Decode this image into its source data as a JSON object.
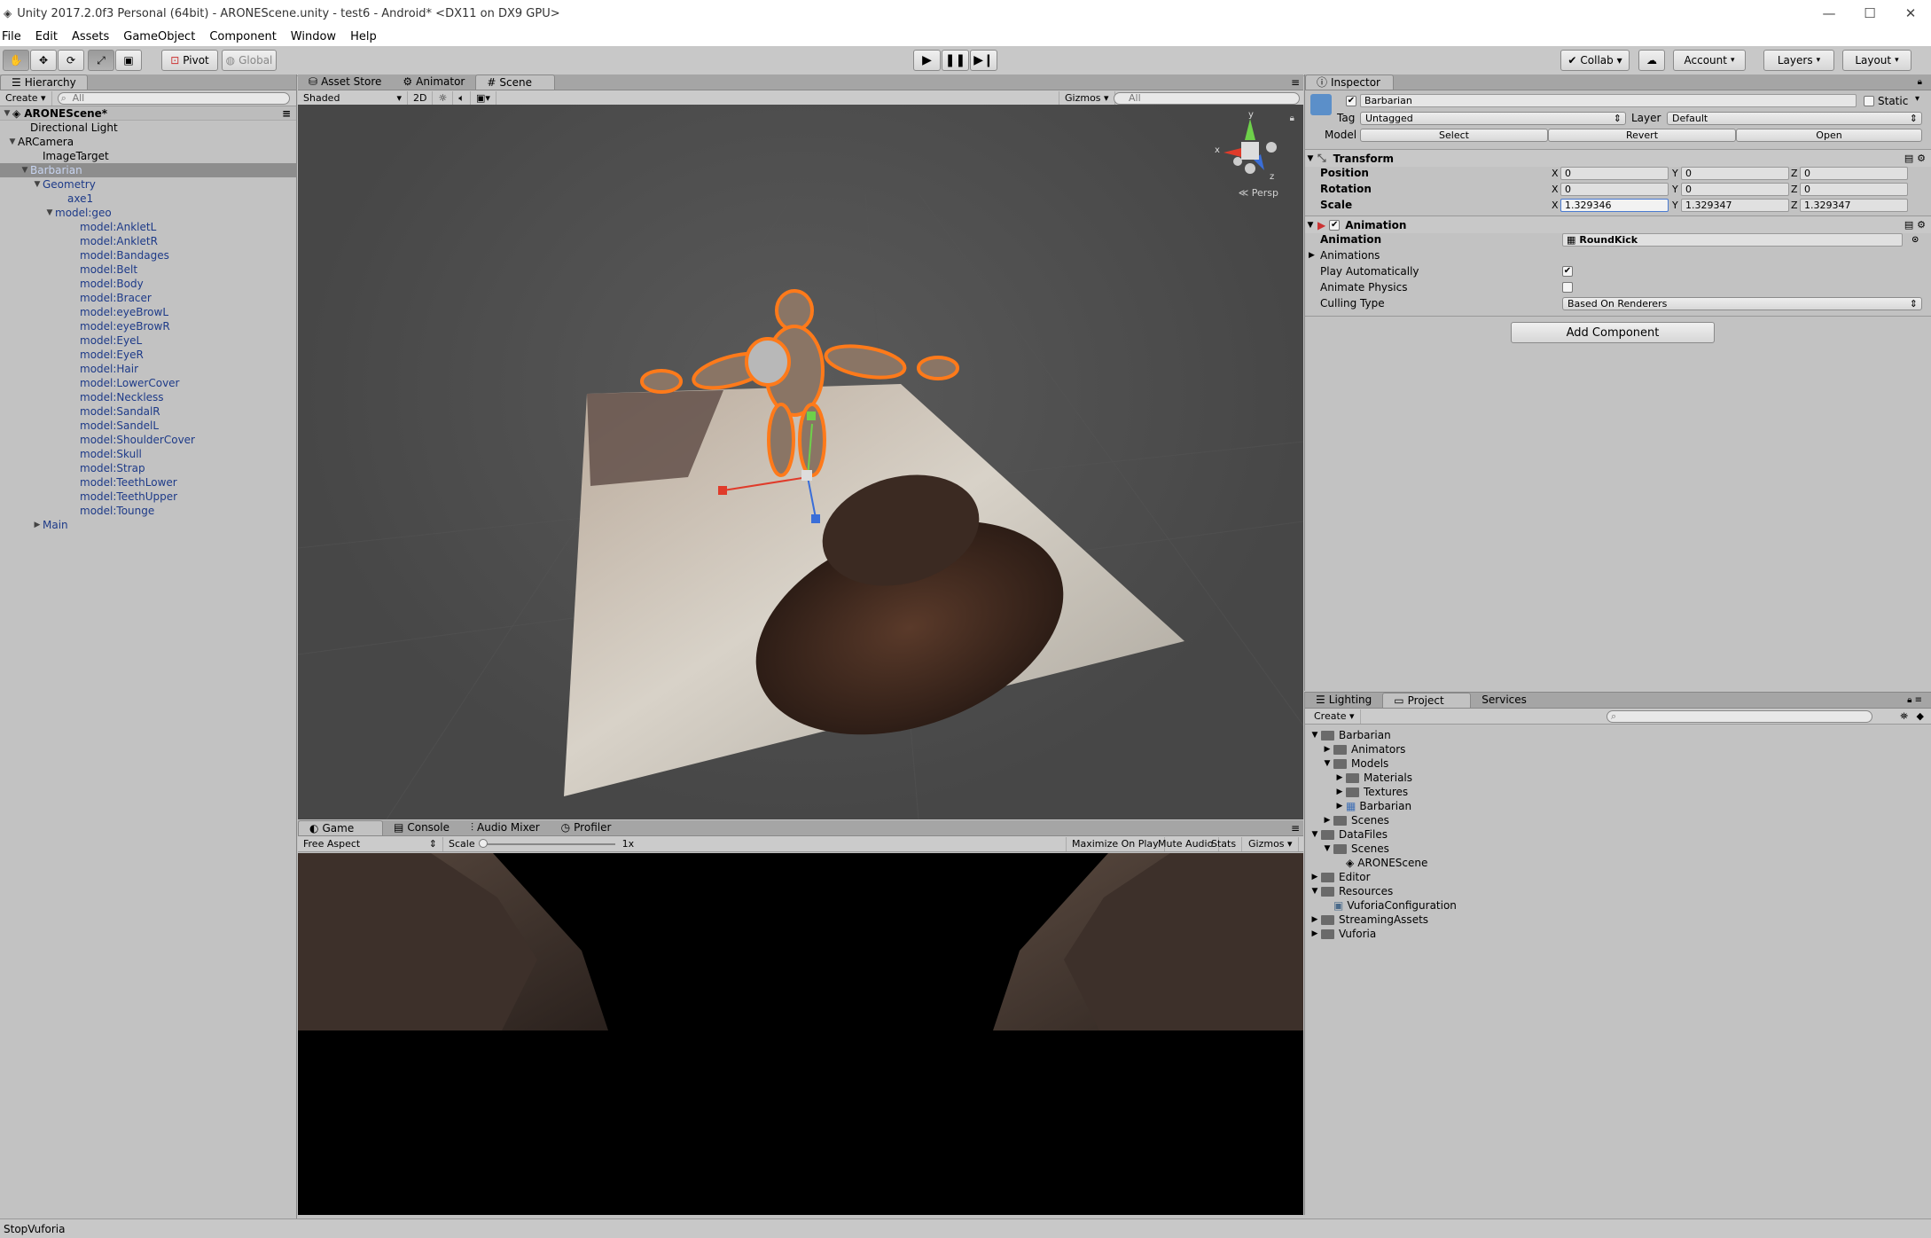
{
  "window": {
    "title": "Unity 2017.2.0f3 Personal (64bit) - ARONEScene.unity - test6 - Android* <DX11 on DX9 GPU>"
  },
  "menu": [
    "File",
    "Edit",
    "Assets",
    "GameObject",
    "Component",
    "Window",
    "Help"
  ],
  "toolbar": {
    "pivot": "Pivot",
    "global": "Global",
    "collab": "Collab ▾",
    "account": "Account",
    "layers": "Layers",
    "layout": "Layout"
  },
  "hierarchy": {
    "tab": "Hierarchy",
    "create": "Create ▾",
    "search": "All",
    "scene": "ARONEScene*",
    "items": [
      {
        "label": "Directional Light",
        "indent": 1,
        "arrow": "",
        "style": ""
      },
      {
        "label": "ARCamera",
        "indent": 0,
        "arrow": "▼",
        "style": ""
      },
      {
        "label": "ImageTarget",
        "indent": 2,
        "arrow": "",
        "style": ""
      },
      {
        "label": "Barbarian",
        "indent": 1,
        "arrow": "▼",
        "style": "sel"
      },
      {
        "label": "Geometry",
        "indent": 2,
        "arrow": "▼",
        "style": "blue"
      },
      {
        "label": "axe1",
        "indent": 4,
        "arrow": "",
        "style": "blue"
      },
      {
        "label": "model:geo",
        "indent": 3,
        "arrow": "▼",
        "style": "blue"
      },
      {
        "label": "model:AnkletL",
        "indent": 5,
        "arrow": "",
        "style": "blue"
      },
      {
        "label": "model:AnkletR",
        "indent": 5,
        "arrow": "",
        "style": "blue"
      },
      {
        "label": "model:Bandages",
        "indent": 5,
        "arrow": "",
        "style": "blue"
      },
      {
        "label": "model:Belt",
        "indent": 5,
        "arrow": "",
        "style": "blue"
      },
      {
        "label": "model:Body",
        "indent": 5,
        "arrow": "",
        "style": "blue"
      },
      {
        "label": "model:Bracer",
        "indent": 5,
        "arrow": "",
        "style": "blue"
      },
      {
        "label": "model:eyeBrowL",
        "indent": 5,
        "arrow": "",
        "style": "blue"
      },
      {
        "label": "model:eyeBrowR",
        "indent": 5,
        "arrow": "",
        "style": "blue"
      },
      {
        "label": "model:EyeL",
        "indent": 5,
        "arrow": "",
        "style": "blue"
      },
      {
        "label": "model:EyeR",
        "indent": 5,
        "arrow": "",
        "style": "blue"
      },
      {
        "label": "model:Hair",
        "indent": 5,
        "arrow": "",
        "style": "blue"
      },
      {
        "label": "model:LowerCover",
        "indent": 5,
        "arrow": "",
        "style": "blue"
      },
      {
        "label": "model:Neckless",
        "indent": 5,
        "arrow": "",
        "style": "blue"
      },
      {
        "label": "model:SandalR",
        "indent": 5,
        "arrow": "",
        "style": "blue"
      },
      {
        "label": "model:SandelL",
        "indent": 5,
        "arrow": "",
        "style": "blue"
      },
      {
        "label": "model:ShoulderCover",
        "indent": 5,
        "arrow": "",
        "style": "blue"
      },
      {
        "label": "model:Skull",
        "indent": 5,
        "arrow": "",
        "style": "blue"
      },
      {
        "label": "model:Strap",
        "indent": 5,
        "arrow": "",
        "style": "blue"
      },
      {
        "label": "model:TeethLower",
        "indent": 5,
        "arrow": "",
        "style": "blue"
      },
      {
        "label": "model:TeethUpper",
        "indent": 5,
        "arrow": "",
        "style": "blue"
      },
      {
        "label": "model:Tounge",
        "indent": 5,
        "arrow": "",
        "style": "blue"
      },
      {
        "label": "Main",
        "indent": 2,
        "arrow": "▶",
        "style": "blue"
      }
    ]
  },
  "scene": {
    "tabs": [
      "Asset Store",
      "Animator",
      "Scene"
    ],
    "shading": "Shaded",
    "mode2d": "2D",
    "gizmos": "Gizmos ▾",
    "search": "All",
    "persp": "Persp",
    "axis_x": "x",
    "axis_y": "y",
    "axis_z": "z"
  },
  "game": {
    "tabs": [
      "Game",
      "Console",
      "Audio Mixer",
      "Profiler"
    ],
    "aspect": "Free Aspect",
    "scale_label": "Scale",
    "scale_value": "1x",
    "maximize": "Maximize On Play",
    "mute": "Mute Audio",
    "stats": "Stats",
    "gizmos": "Gizmos ▾"
  },
  "inspector": {
    "tab": "Inspector",
    "name": "Barbarian",
    "static": "Static",
    "tag_label": "Tag",
    "tag": "Untagged",
    "layer_label": "Layer",
    "layer": "Default",
    "model_label": "Model",
    "select": "Select",
    "revert": "Revert",
    "open": "Open",
    "transform": {
      "title": "Transform",
      "rows": [
        {
          "label": "Position",
          "x": "0",
          "y": "0",
          "z": "0"
        },
        {
          "label": "Rotation",
          "x": "0",
          "y": "0",
          "z": "0"
        },
        {
          "label": "Scale",
          "x": "1.329346",
          "y": "1.329347",
          "z": "1.329347"
        }
      ]
    },
    "animation": {
      "title": "Animation",
      "anim_label": "Animation",
      "anim_value": "RoundKick",
      "animations": "Animations",
      "play_auto": "Play Automatically",
      "physics": "Animate Physics",
      "culling_label": "Culling Type",
      "culling": "Based On Renderers"
    },
    "add_component": "Add Component"
  },
  "project": {
    "tabs": [
      "Lighting",
      "Project",
      "Services"
    ],
    "create": "Create ▾",
    "items": [
      {
        "label": "Barbarian",
        "indent": 0,
        "arrow": "▼",
        "kind": "folder"
      },
      {
        "label": "Animators",
        "indent": 1,
        "arrow": "▶",
        "kind": "folder"
      },
      {
        "label": "Models",
        "indent": 1,
        "arrow": "▼",
        "kind": "folder"
      },
      {
        "label": "Materials",
        "indent": 2,
        "arrow": "▶",
        "kind": "folder"
      },
      {
        "label": "Textures",
        "indent": 2,
        "arrow": "▶",
        "kind": "folder"
      },
      {
        "label": "Barbarian",
        "indent": 2,
        "arrow": "▶",
        "kind": "model"
      },
      {
        "label": "Scenes",
        "indent": 1,
        "arrow": "▶",
        "kind": "folder"
      },
      {
        "label": "DataFiles",
        "indent": 0,
        "arrow": "▼",
        "kind": "folder"
      },
      {
        "label": "Scenes",
        "indent": 1,
        "arrow": "▼",
        "kind": "folder"
      },
      {
        "label": "ARONEScene",
        "indent": 2,
        "arrow": "",
        "kind": "scene"
      },
      {
        "label": "Editor",
        "indent": 0,
        "arrow": "▶",
        "kind": "folder"
      },
      {
        "label": "Resources",
        "indent": 0,
        "arrow": "▼",
        "kind": "folder"
      },
      {
        "label": "VuforiaConfiguration",
        "indent": 1,
        "arrow": "",
        "kind": "asset"
      },
      {
        "label": "StreamingAssets",
        "indent": 0,
        "arrow": "▶",
        "kind": "folder"
      },
      {
        "label": "Vuforia",
        "indent": 0,
        "arrow": "▶",
        "kind": "folder"
      }
    ]
  },
  "status": "StopVuforia"
}
